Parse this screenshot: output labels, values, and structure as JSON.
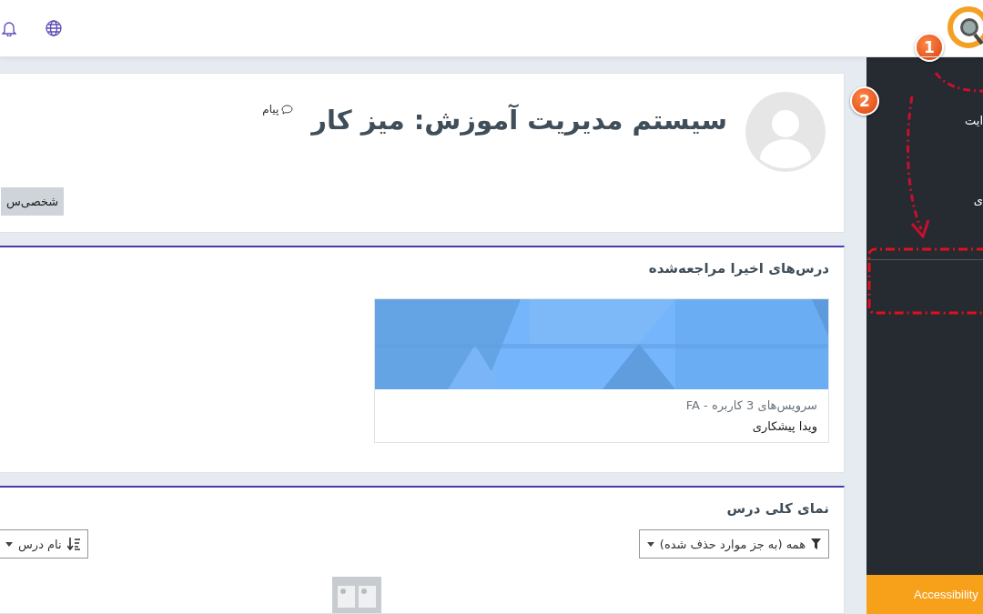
{
  "profile": {
    "title": "سیستم مدیریت آموزش: میز کار",
    "message_link": "پیام",
    "button": "شخصی‌س"
  },
  "recent_courses": {
    "heading": "درس‌های اخیرا مراجعه‌شده",
    "courses": [
      {
        "category": "سرویس‌های 3 کاربره - FA",
        "name": "ویدا پیشکاری"
      }
    ]
  },
  "course_overview": {
    "heading": "نمای کلی درس",
    "filter": "همه (به جز موارد حذف شده)",
    "sort": "نام درس"
  },
  "sidebar": {
    "items": [
      "ایت",
      "ی"
    ],
    "accessibility_button": "Accessibility"
  },
  "annotations": {
    "badges": [
      "1",
      "2"
    ]
  }
}
